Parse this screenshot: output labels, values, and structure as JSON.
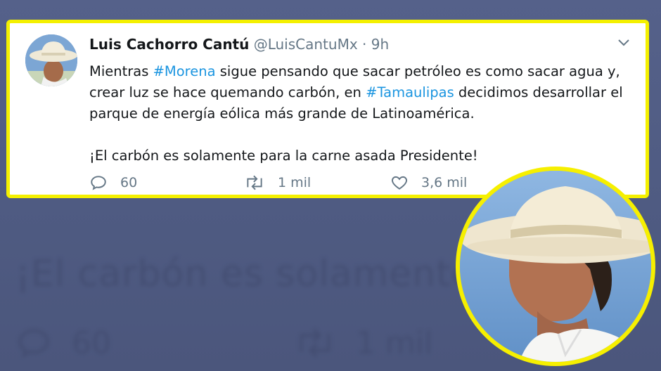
{
  "tweet": {
    "author_name": "Luis Cachorro Cantú",
    "handle": "@LuisCantuMx",
    "separator": "·",
    "time": "9h",
    "text_before_tag1": "Mientras ",
    "hashtag1": "#Morena",
    "text_after_tag1": " sigue pensando que sacar petróleo es como sacar agua y, crear luz se hace quemando carbón, en ",
    "hashtag2": "#Tamaulipas",
    "text_after_tag2": " decidimos desarrollar el parque de energía eólica más grande de Latinoamérica.",
    "paragraph2": "¡El carbón es solamente para la carne asada Presidente!",
    "replies": "60",
    "retweets": "1 mil",
    "likes": "3,6 mil"
  },
  "background": {
    "blurred_text": "¡El carbón es solamente pa",
    "blurred_replies": "60",
    "blurred_retweets": "1 mil"
  },
  "colors": {
    "highlight_border": "#f4f000",
    "hashtag": "#1b95e0",
    "background": "#55618a"
  }
}
